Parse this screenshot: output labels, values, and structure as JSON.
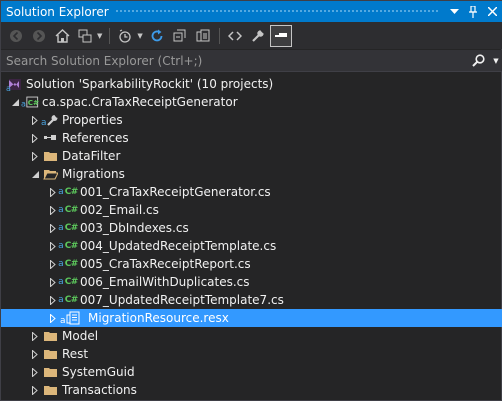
{
  "window": {
    "title": "Solution Explorer"
  },
  "toolbar": {
    "buttons": [
      "back",
      "forward",
      "home",
      "switch-views",
      "pending-changes-filter",
      "sync",
      "collapse-all",
      "show-all-files",
      "view-code",
      "properties",
      "preview-selected"
    ]
  },
  "search": {
    "placeholder": "Search Solution Explorer (Ctrl+;)",
    "value": ""
  },
  "tree": {
    "solution": "Solution 'SparkabilityRockit' (10 projects)",
    "project": "ca.spac.CraTaxReceiptGenerator",
    "items": {
      "properties": "Properties",
      "references": "References",
      "datafilter": "DataFilter",
      "migrations": "Migrations",
      "model": "Model",
      "rest": "Rest",
      "systemguid": "SystemGuid",
      "transactions": "Transactions"
    },
    "migration_files": [
      "001_CraTaxReceiptGenerator.cs",
      "002_Email.cs",
      "003_DbIndexes.cs",
      "004_UpdatedReceiptTemplate.cs",
      "005_CraTaxReceiptReport.cs",
      "006_EmailWithDuplicates.cs",
      "007_UpdatedReceiptTemplate7.cs"
    ],
    "selected_file": "MigrationResource.resx"
  },
  "colors": {
    "accent": "#007acc",
    "selection": "#3399ff",
    "background": "#252526",
    "folder": "#dcb67a",
    "csharp": "#5cc85c"
  }
}
